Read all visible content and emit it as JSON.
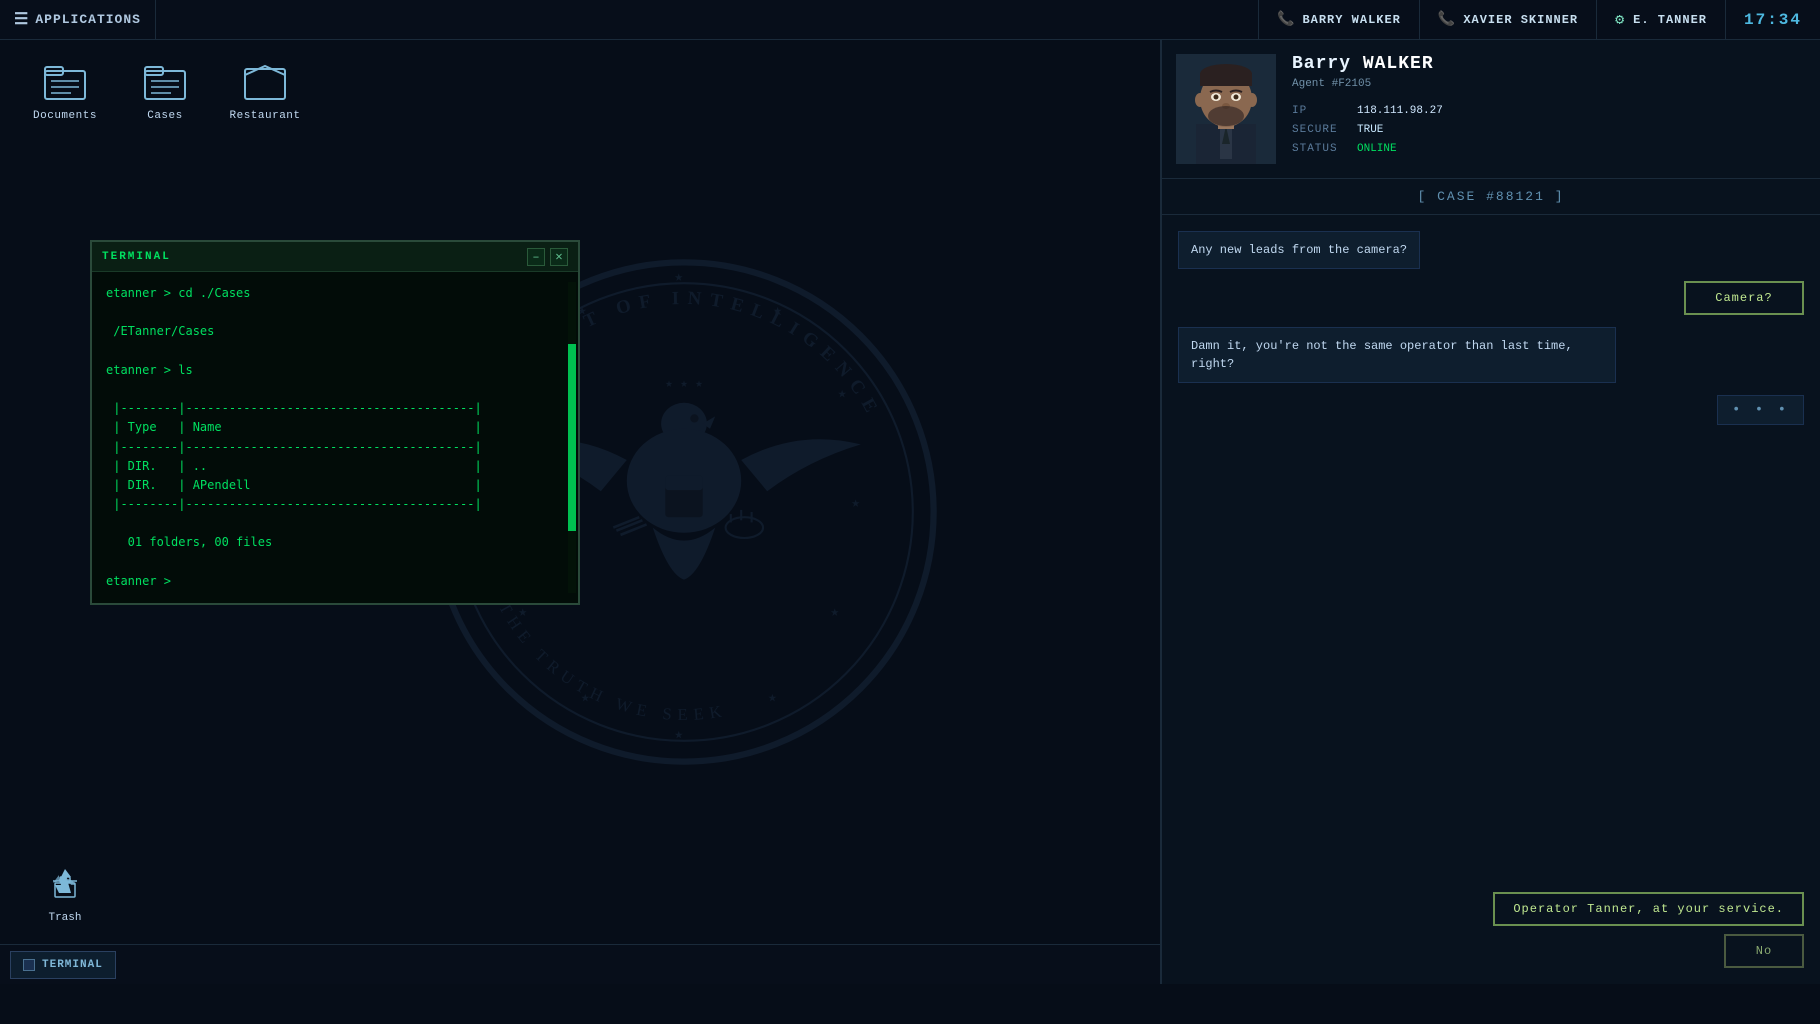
{
  "topbar": {
    "apps_label": "APPLICATIONS",
    "contact1": "BARRY WALKER",
    "contact2": "XAVIER SKINNER",
    "tanner": "E. TANNER",
    "time": "17:34"
  },
  "desktop_icons": [
    {
      "label": "Documents",
      "icon": "🗂"
    },
    {
      "label": "Cases",
      "icon": "🗃"
    },
    {
      "label": "Restaurant",
      "icon": "📁"
    }
  ],
  "trash": {
    "label": "Trash",
    "icon": "♻"
  },
  "terminal": {
    "title": "TERMINAL",
    "content": "etanner > cd ./Cases\n\n /ETanner/Cases\n\netanner > ls\n\n |--------|----------------------------------------|\n | Type   | Name                                   |\n |--------|----------------------------------------|\n | DIR.   | ..                                     |\n | DIR.   | APendell                               |\n |--------|----------------------------------------|\n\n   01 folders, 00 files\n\netanner > "
  },
  "agent": {
    "first_name": "Barry",
    "last_name": "WALKER",
    "id": "Agent #F2105",
    "ip": "118.111.98.27",
    "secure": "TRUE",
    "status": "ONLINE"
  },
  "case_badge": "[ CASE #88121 ]",
  "chat": {
    "msg1": "Any new leads from the camera?",
    "msg1_btn": "Camera?",
    "msg2": "Damn it, you're not the same operator than last time, right?",
    "dots": "• • •",
    "option1": "Operator Tanner, at your service.",
    "option2": "No"
  },
  "taskbar": {
    "item_label": "TERMINAL"
  }
}
